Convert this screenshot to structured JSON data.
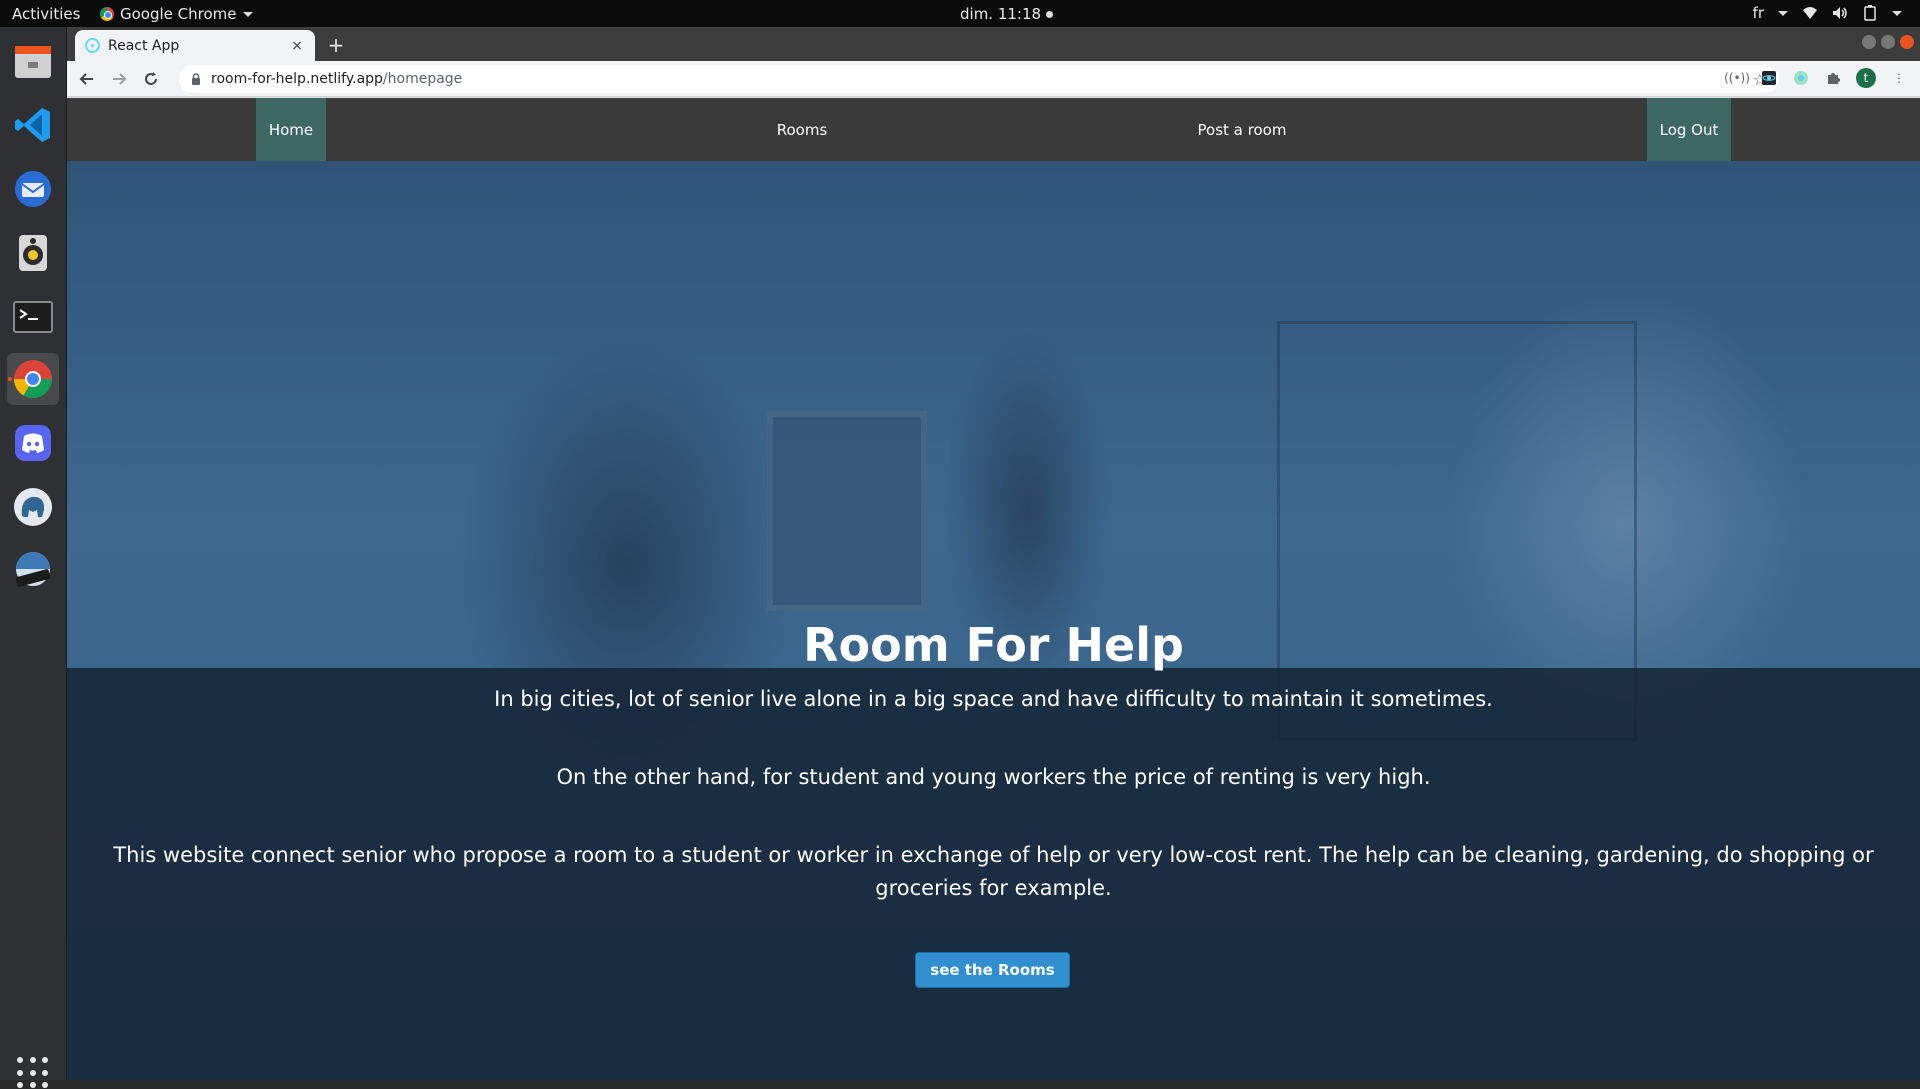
{
  "system_bar": {
    "activities": "Activities",
    "app_name": "Google Chrome",
    "clock": "dim. 11:18",
    "language": "fr"
  },
  "dock": {
    "items": [
      "files",
      "vscode",
      "thunderbird",
      "rhythmbox",
      "terminal",
      "chrome",
      "discord",
      "postgres",
      "video-app"
    ]
  },
  "browser": {
    "tab_title": "React App",
    "tab_close": "×",
    "new_tab": "+",
    "url_host": "room-for-help.netlify.app",
    "url_path": "/homepage",
    "profile_initial": "t"
  },
  "nav": {
    "home": "Home",
    "rooms": "Rooms",
    "post_room": "Post a room",
    "logout": "Log Out"
  },
  "hero": {
    "title": "Room For Help",
    "paragraph_1": "In big cities, lot of senior live alone in a big space and have difficulty to maintain it sometimes.",
    "paragraph_2": "On the other hand, for student and young workers the price of renting is very high.",
    "paragraph_3": "This website connect senior who propose a room to a student or worker in exchange of help or very low-cost rent. The help can be cleaning, gardening, do shopping or groceries for example.",
    "cta_label": "see the Rooms"
  },
  "colors": {
    "nav_bg": "#3a3a3a",
    "nav_highlight": "#3e6864",
    "cta_bg": "#2f8fcf",
    "overlay": "#14223280"
  }
}
